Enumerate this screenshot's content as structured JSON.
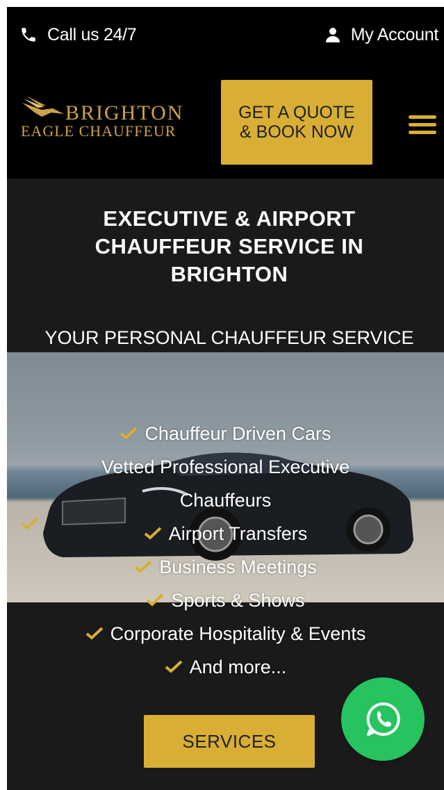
{
  "topbar": {
    "call_label": "Call us 24/7",
    "account_label": "My Account",
    "call_icon": "phone-icon",
    "account_icon": "user-icon"
  },
  "header": {
    "logo_line1": "BRIGHTON",
    "logo_line2": "EAGLE CHAUFFEUR",
    "quote_button": "GET A QUOTE & BOOK NOW",
    "menu_icon": "hamburger-menu-icon"
  },
  "hero": {
    "title": "EXECUTIVE & AIRPORT CHAUFFEUR SERVICE IN BRIGHTON",
    "subtitle": "YOUR PERSONAL CHAUFFEUR SERVICE",
    "features": [
      "Chauffeur Driven Cars",
      "Vetted Professional Executive Chauffeurs",
      "Airport Transfers",
      "Business Meetings",
      "Sports & Shows",
      "Corporate Hospitality & Events",
      "And more..."
    ],
    "services_button": "SERVICES"
  },
  "widgets": {
    "whatsapp_icon": "whatsapp-icon"
  },
  "colors": {
    "accent": "#d8ae35",
    "background": "#1b1a1a",
    "topbar": "#000000",
    "whatsapp": "#27c35f"
  }
}
